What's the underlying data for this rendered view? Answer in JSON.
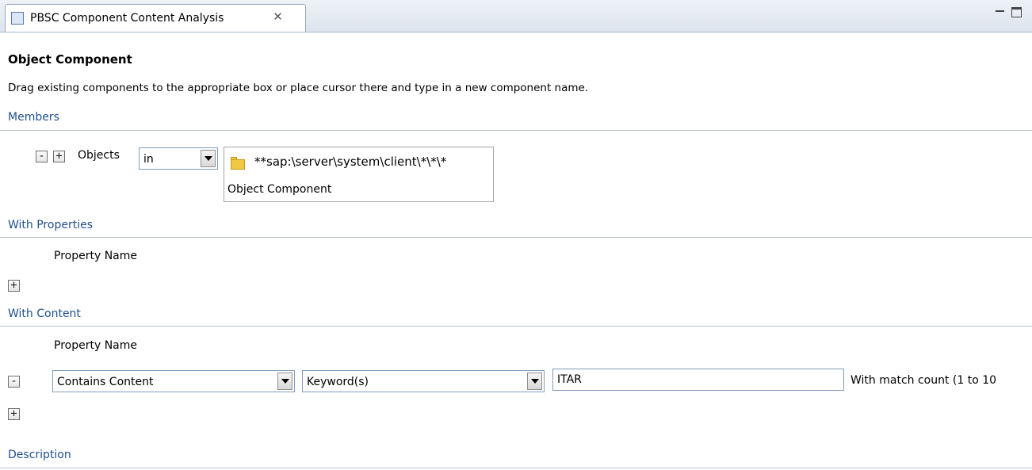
{
  "tab": {
    "title": "PBSC Component Content Analysis",
    "close_glyph": "✕",
    "icon": "component-analysis-icon"
  },
  "window_controls": {
    "minimize": "minimize-icon",
    "maximize": "maximize-icon"
  },
  "heading": "Object Component",
  "subtitle": "Drag existing components to the appropriate box or place cursor there and type in a new component name.",
  "members": {
    "title": "Members",
    "minus": "-",
    "plus": "+",
    "objects_label": "Objects",
    "operator_value": "in",
    "component_path": "**sap:\\server\\system\\client\\*\\*\\*",
    "component_caption": "Object Component"
  },
  "with_properties": {
    "title": "With Properties",
    "column_header": "Property Name",
    "plus": "+"
  },
  "with_content": {
    "title": "With Content",
    "column_header": "Property Name",
    "minus": "-",
    "condition_value": "Contains Content",
    "match_type_value": "Keyword(s)",
    "keyword_value": "ITAR",
    "match_count_label": "With match count (1 to 10",
    "plus": "+"
  },
  "description": {
    "title": "Description"
  },
  "colors": {
    "section_title": "#1f4f8f",
    "tab_border": "#99a8bd",
    "field_border": "#7f9db9"
  }
}
